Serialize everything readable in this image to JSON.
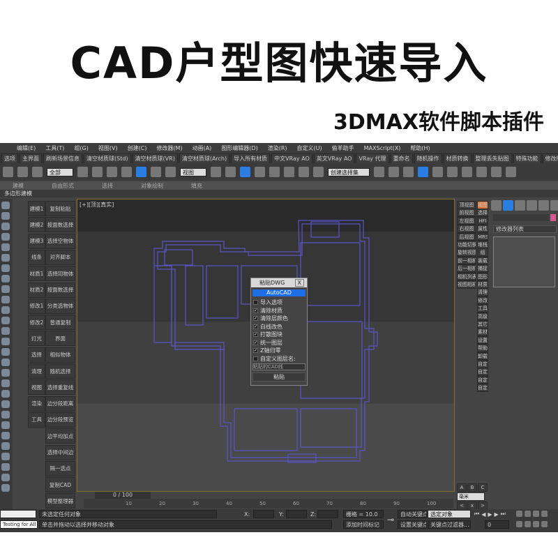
{
  "banner": {
    "title": "CAD户型图快速导入",
    "subtitle": "3DMAX软件脚本插件"
  },
  "menu": [
    "编辑(E)",
    "工具(T)",
    "组(G)",
    "视图(V)",
    "创建(C)",
    "修改器(M)",
    "动画(A)",
    "图形编辑器(D)",
    "渲染(R)",
    "自定义(U)",
    "偷羊助手",
    "MAXScript(X)",
    "帮助(H)"
  ],
  "shelf": [
    "选项",
    "主界面",
    "刷新场景信息",
    "清空材质球(Std)",
    "清空材质球(VR)",
    "清空材质球(Arch)",
    "导入所有材质",
    "中文VRay AO",
    "英文VRay AO",
    "VRay 代理",
    "重命名",
    "随机操作",
    "材质转换",
    "整理丢失贴图",
    "特殊功能",
    "修改所有VRay材质"
  ],
  "toolbar": {
    "filter": "全部",
    "refcoord": "视图",
    "selset": "创建选择集"
  },
  "ribbon": [
    "建模",
    "自由形式",
    "选择",
    "对象绘制",
    "填充"
  ],
  "polybar": "多边形建模",
  "left_col1": [
    "建模1",
    "建模2",
    "建模3",
    "线条",
    "材质1",
    "材质2",
    "修改1",
    "修改2",
    "灯光",
    "选择",
    "清理",
    "视图",
    "渲染",
    "工具"
  ],
  "left_col2": [
    "复制粘贴",
    "按面数选择",
    "选择空物体",
    "对齐脚本",
    "选择同物体",
    "按面数选择",
    "分类选物体",
    "普通复制",
    "界面",
    "相似物体",
    "随机选择",
    "选择重复线",
    "边分段距离",
    "边分段预览",
    "边平均加点",
    "选择中间边",
    "隔一选点",
    "复制CAD",
    "模型整理器"
  ],
  "viewport": {
    "label": "[+][顶][真实]"
  },
  "dialog": {
    "title": "粘贴DWG",
    "close": "X",
    "tab": "AutoCAD",
    "options": [
      {
        "label": "导入选项",
        "checked": false
      },
      {
        "label": "清除材质",
        "checked": true
      },
      {
        "label": "清除层颜色",
        "checked": true
      },
      {
        "label": "白线改色",
        "checked": true
      },
      {
        "label": "打散图块",
        "checked": true
      },
      {
        "label": "统一图层",
        "checked": true
      },
      {
        "label": "Z轴归零",
        "checked": true
      },
      {
        "label": "自定义图层名:",
        "checked": false
      }
    ],
    "layer_name": "粘贴的CAD线",
    "paste": "粘贴"
  },
  "right_col1": [
    "顶视图",
    "前视图",
    "左视图",
    "右视图",
    "后视图",
    "功能切换",
    "旋转视图",
    "前一相机",
    "后一相机",
    "相机列表",
    "视图相机"
  ],
  "right_col2": [
    "视图",
    "选择",
    "HFI",
    "属性",
    "MRS",
    "堆栈",
    "组",
    "装载",
    "捕捉",
    "图形",
    "材质",
    "清理",
    "修改",
    "工具",
    "高级",
    "其它",
    "素材",
    "设置",
    "帮助",
    "卸载",
    "自定",
    "自定",
    "自定",
    "自定"
  ],
  "abc": [
    "A",
    "B",
    "C"
  ],
  "units": "毫米",
  "nav": [
    "<",
    "x",
    ">"
  ],
  "command_panel": {
    "modifier_list": "修改器列表"
  },
  "timeline": {
    "frame": "0 / 100",
    "ticks": [
      "10",
      "20",
      "30",
      "40",
      "50",
      "60",
      "70",
      "80",
      "90",
      "100"
    ]
  },
  "status": {
    "script_listener": "Testing for All",
    "selection": "未选定任何对象",
    "prompt": "单击并拖动以选择并移动对象",
    "x_label": "X:",
    "y_label": "Y:",
    "z_label": "Z:",
    "grid": "栅格 = 10.0",
    "add_time_tag": "添加时间标记",
    "auto_key": "自动关键点",
    "set_key": "设置关键点",
    "key_target": "选定对象",
    "key_filters": "关键点过滤器...",
    "frame": "0"
  },
  "colors": {
    "accent": "#1e6fe6",
    "plan_lines": "#5a55c8",
    "viewport_border": "#8a6d2a"
  }
}
